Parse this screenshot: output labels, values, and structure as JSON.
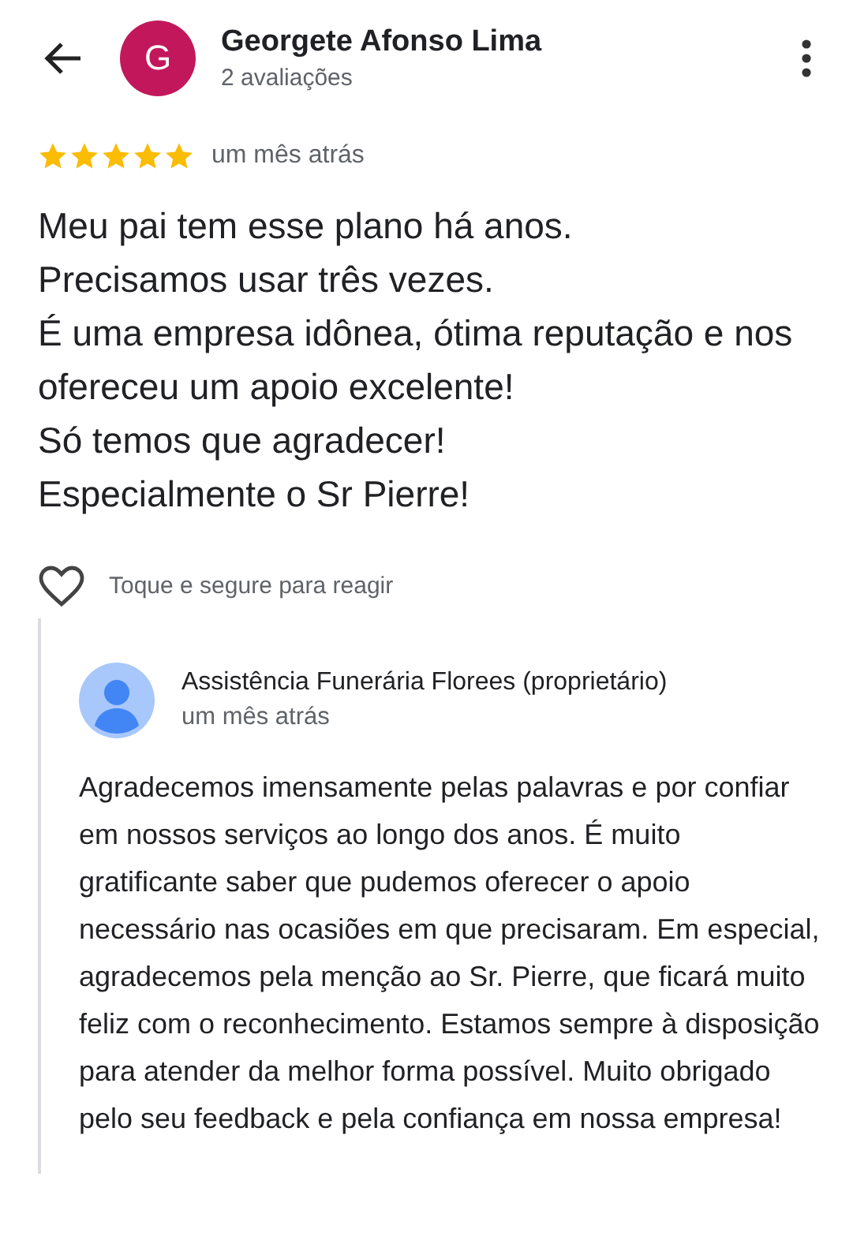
{
  "header": {
    "avatar_letter": "G",
    "name": "Georgete Afonso Lima",
    "subtitle": "2 avaliações"
  },
  "review": {
    "stars": 5,
    "date": "um mês atrás",
    "lines": [
      "Meu pai tem esse plano há anos.",
      "Precisamos usar três vezes.",
      "É uma empresa idônea, ótima reputação e nos ofereceu um apoio excelente!",
      "Só temos que agradecer!",
      "Especialmente o Sr Pierre!"
    ]
  },
  "reaction": {
    "liked": false,
    "hint": "Toque e segure para reagir"
  },
  "reply": {
    "author": "Assistência Funerária Florees (proprietário)",
    "date": "um mês atrás",
    "text": "Agradecemos imensamente pelas palavras e por confiar em nossos serviços ao longo dos anos. É muito gratificante saber que pudemos oferecer o apoio necessário nas ocasiões em que precisaram. Em especial, agradecemos pela menção ao Sr. Pierre, que ficará muito feliz com o reconhecimento. Estamos sempre à disposição para atender da melhor forma possível. Muito obrigado pelo seu feedback e pela confiança em nossa empresa!"
  }
}
